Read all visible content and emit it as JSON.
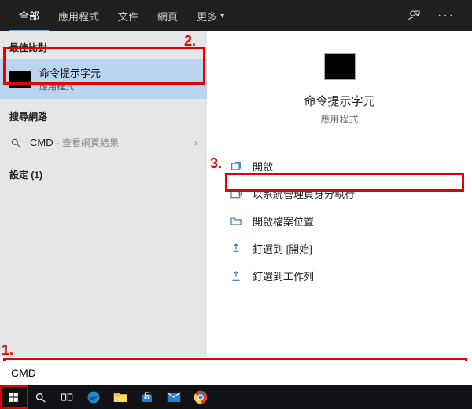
{
  "topbar": {
    "tabs": [
      "全部",
      "應用程式",
      "文件",
      "網頁"
    ],
    "more": "更多"
  },
  "left": {
    "best_label": "最佳比對",
    "best_title": "命令提示字元",
    "best_sub": "應用程式",
    "web_label": "搜尋網路",
    "web_text": "CMD",
    "web_sub": " - 查看網頁結果",
    "settings_label": "設定 (1)"
  },
  "right": {
    "title": "命令提示字元",
    "sub": "應用程式",
    "actions": [
      "開啟",
      "以系統管理員身分執行",
      "開啟檔案位置",
      "釘選到 [開始]",
      "釘選到工作列"
    ]
  },
  "search": {
    "value": "CMD"
  },
  "anno": {
    "one": "1.",
    "two": "2.",
    "three": "3."
  }
}
